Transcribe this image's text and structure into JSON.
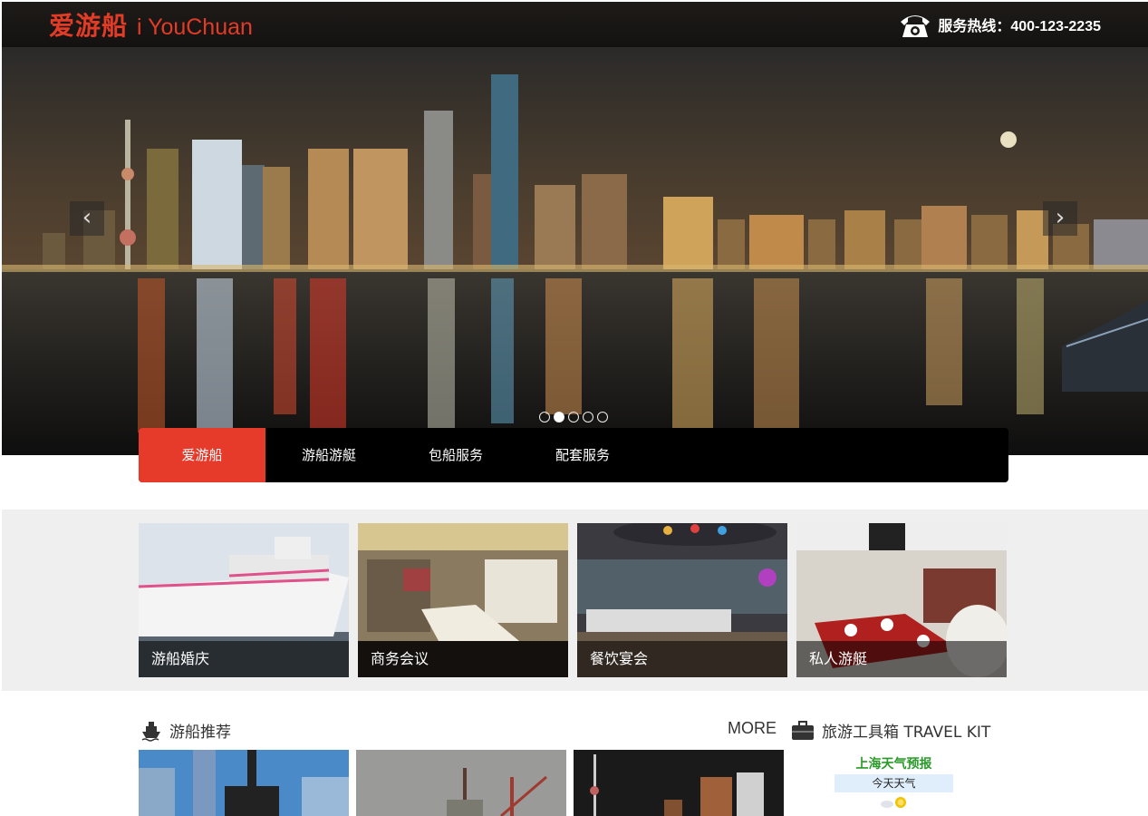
{
  "header": {
    "logo_cn": "爱游船",
    "logo_en": "i YouChuan",
    "hotline": "服务热线：400-123-2235"
  },
  "hero": {
    "prev_arrow": "‹",
    "next_arrow": "›",
    "slide_count": 5,
    "active_slide": 2
  },
  "nav": {
    "items": [
      "爱游船",
      "游船游艇",
      "包船服务",
      "配套服务"
    ],
    "active_index": 0
  },
  "services": [
    {
      "label": "游船婚庆"
    },
    {
      "label": "商务会议"
    },
    {
      "label": "餐饮宴会"
    },
    {
      "label": "私人游艇"
    }
  ],
  "recommend": {
    "title": "游船推荐",
    "more": "MORE"
  },
  "toolkit": {
    "title": "旅游工具箱 TRAVEL KIT"
  },
  "weather": {
    "title": "上海天气预报",
    "today": "今天天气"
  },
  "colors": {
    "accent": "#e63a2b",
    "header_bg": "#1a1715",
    "nav_bg": "#000000",
    "services_bg": "#efefef"
  }
}
